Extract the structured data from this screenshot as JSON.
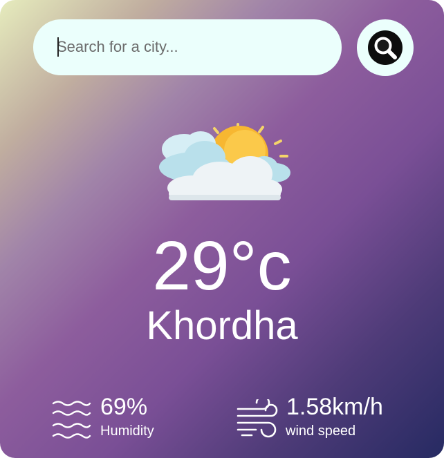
{
  "search": {
    "placeholder": "Search for a city...",
    "value": ""
  },
  "icons": {
    "search_button": "magnifier-icon",
    "weather": "partly-cloudy-sun-icon",
    "humidity": "humidity-waves-icon",
    "wind": "wind-icon"
  },
  "weather": {
    "temperature": "29°c",
    "city": "Khordha"
  },
  "details": {
    "humidity": {
      "value": "69%",
      "label": "Humidity"
    },
    "wind": {
      "value": "1.58km/h",
      "label": "wind speed"
    }
  },
  "colors": {
    "gradient_start": "#e6ecbd",
    "gradient_mid": "#8d5d9d",
    "gradient_end": "#262a62",
    "input_bg": "#ebfffc",
    "text": "#ffffff"
  }
}
